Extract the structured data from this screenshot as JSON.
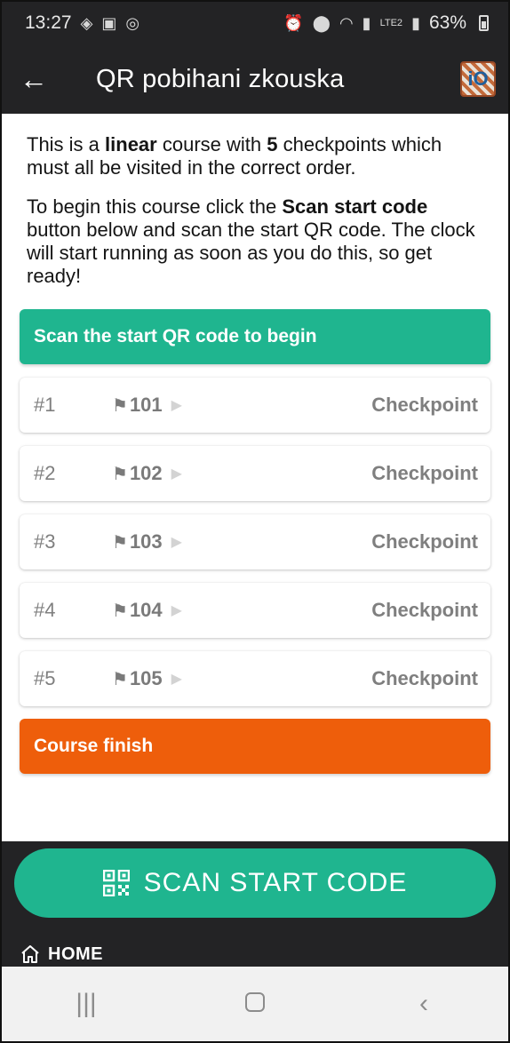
{
  "status_bar": {
    "time": "13:27",
    "battery": "63%",
    "network": "LTE2"
  },
  "app_bar": {
    "title": "QR pobihani zkouska",
    "logo_text": "iO"
  },
  "intro": {
    "p1_a": "This is a ",
    "p1_b": "linear",
    "p1_c": " course with ",
    "p1_d": "5",
    "p1_e": " checkpoints which must all be visited in the correct order.",
    "p2_a": "To begin this course click the ",
    "p2_b": "Scan start code",
    "p2_c": " button below and scan the start QR code. The clock will start running as soon as you do this, so get ready!"
  },
  "start_banner": "Scan the start QR code to begin",
  "checkpoints": [
    {
      "num": "#1",
      "code": "101",
      "label": "Checkpoint"
    },
    {
      "num": "#2",
      "code": "102",
      "label": "Checkpoint"
    },
    {
      "num": "#3",
      "code": "103",
      "label": "Checkpoint"
    },
    {
      "num": "#4",
      "code": "104",
      "label": "Checkpoint"
    },
    {
      "num": "#5",
      "code": "105",
      "label": "Checkpoint"
    }
  ],
  "finish_banner": "Course finish",
  "scan_button": "SCAN START CODE",
  "home_link": "HOME",
  "colors": {
    "accent_green": "#1fb58f",
    "finish_orange": "#ee5e0b",
    "dark_bar": "#232325"
  }
}
